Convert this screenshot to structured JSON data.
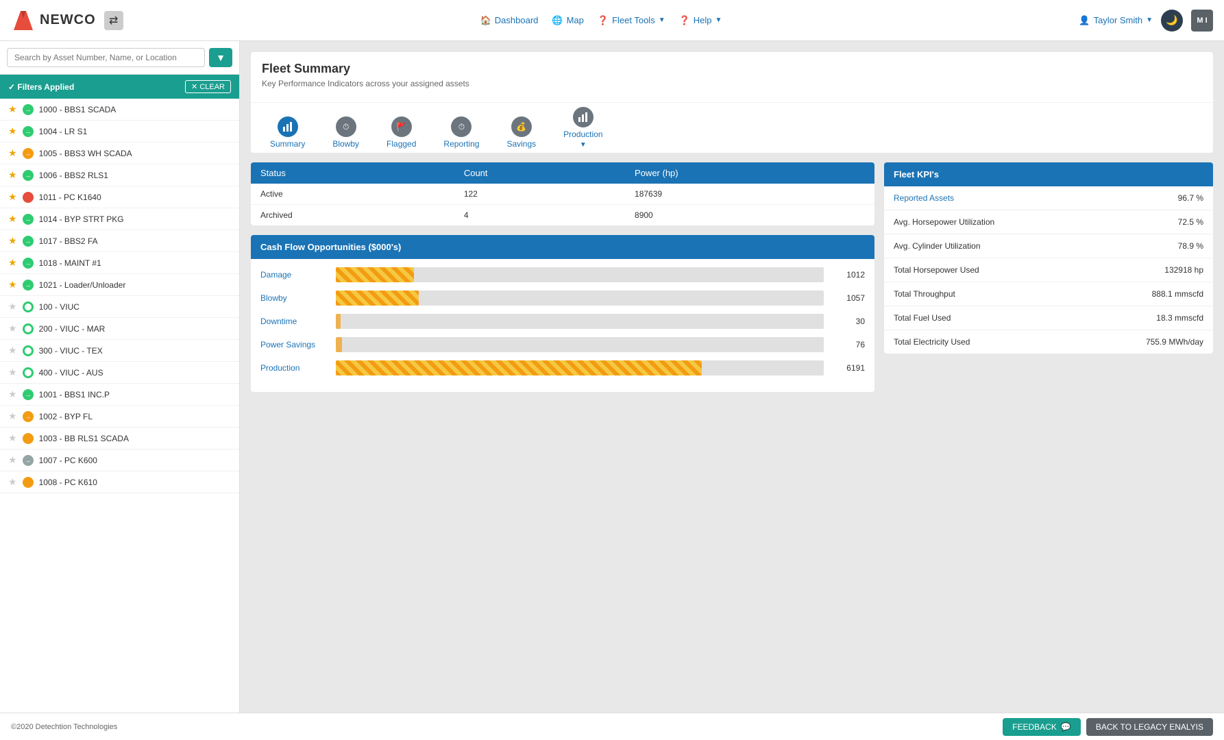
{
  "header": {
    "logo_text": "NEWCO",
    "nav_items": [
      {
        "label": "Dashboard",
        "icon": "🏠"
      },
      {
        "label": "Map",
        "icon": "🌐"
      },
      {
        "label": "Fleet Tools",
        "icon": "❓",
        "has_dropdown": true
      },
      {
        "label": "Help",
        "icon": "❓",
        "has_dropdown": true
      }
    ],
    "user_name": "Taylor Smith",
    "avatar_initials": "M I",
    "dark_mode_icon": "🌙"
  },
  "sidebar": {
    "search_placeholder": "Search by Asset Number, Name, or Location",
    "filters_applied_label": "✓ Filters Applied",
    "clear_label": "✕ CLEAR",
    "assets": [
      {
        "id": "1000",
        "name": "1000 - BBS1 SCADA",
        "starred": true,
        "status": "green-arrow"
      },
      {
        "id": "1004",
        "name": "1004 - LR S1",
        "starred": true,
        "status": "green-arrow"
      },
      {
        "id": "1005",
        "name": "1005 - BBS3 WH SCADA",
        "starred": true,
        "status": "orange-arrow"
      },
      {
        "id": "1006",
        "name": "1006 - BBS2 RLS1",
        "starred": true,
        "status": "green-arrow"
      },
      {
        "id": "1011",
        "name": "1011 - PC K1640",
        "starred": true,
        "status": "red-solid"
      },
      {
        "id": "1014",
        "name": "1014 - BYP STRT PKG",
        "starred": true,
        "status": "green-arrow"
      },
      {
        "id": "1017",
        "name": "1017 - BBS2 FA",
        "starred": true,
        "status": "green-arrow"
      },
      {
        "id": "1018",
        "name": "1018 - MAINT #1",
        "starred": true,
        "status": "green-arrow"
      },
      {
        "id": "1021",
        "name": "1021 - Loader/Unloader",
        "starred": true,
        "status": "green-arrow"
      },
      {
        "id": "100",
        "name": "100 - VIUC",
        "starred": false,
        "status": "ring-green"
      },
      {
        "id": "200",
        "name": "200 - VIUC - MAR",
        "starred": false,
        "status": "ring-green"
      },
      {
        "id": "300",
        "name": "300 - VIUC - TEX",
        "starred": false,
        "status": "ring-green"
      },
      {
        "id": "400",
        "name": "400 - VIUC - AUS",
        "starred": false,
        "status": "ring-green"
      },
      {
        "id": "1001",
        "name": "1001 - BBS1 INC.P",
        "starred": false,
        "status": "green-arrow"
      },
      {
        "id": "1002",
        "name": "1002 - BYP FL",
        "starred": false,
        "status": "orange-arrow"
      },
      {
        "id": "1003",
        "name": "1003 - BB RLS1 SCADA",
        "starred": false,
        "status": "orange-solid"
      },
      {
        "id": "1007",
        "name": "1007 - PC K600",
        "starred": false,
        "status": "gray-arrow"
      },
      {
        "id": "1008",
        "name": "1008 - PC K610",
        "starred": false,
        "status": "orange-solid"
      }
    ]
  },
  "fleet_summary": {
    "title": "Fleet Summary",
    "subtitle": "Key Performance Indicators across your assigned assets"
  },
  "tabs": [
    {
      "label": "Summary",
      "icon": "📊",
      "active": true,
      "color": "blue"
    },
    {
      "label": "Blowby",
      "icon": "⏱",
      "active": false,
      "color": "gray"
    },
    {
      "label": "Flagged",
      "icon": "🚩",
      "active": false,
      "color": "gray"
    },
    {
      "label": "Reporting",
      "icon": "⏱",
      "active": false,
      "color": "gray"
    },
    {
      "label": "Savings",
      "icon": "💰",
      "active": false,
      "color": "gray"
    },
    {
      "label": "Production",
      "icon": "📊",
      "active": false,
      "color": "gray",
      "has_dropdown": true
    }
  ],
  "status_table": {
    "headers": [
      "Status",
      "Count",
      "Power (hp)"
    ],
    "rows": [
      {
        "status": "Active",
        "count": "122",
        "power": "187639"
      },
      {
        "status": "Archived",
        "count": "4",
        "power": "8900"
      }
    ]
  },
  "cash_flow": {
    "title": "Cash Flow Opportunities ($000's)",
    "bars": [
      {
        "label": "Damage",
        "value": "1012",
        "pct": 16
      },
      {
        "label": "Blowby",
        "value": "1057",
        "pct": 17
      },
      {
        "label": "Downtime",
        "value": "30",
        "pct": 1
      },
      {
        "label": "Power Savings",
        "value": "76",
        "pct": 1.2
      },
      {
        "label": "Production",
        "value": "6191",
        "pct": 75
      }
    ]
  },
  "fleet_kpis": {
    "title": "Fleet KPI's",
    "rows": [
      {
        "label": "Reported Assets",
        "is_link": true,
        "value": "96.7 %"
      },
      {
        "label": "Avg. Horsepower Utilization",
        "is_link": false,
        "value": "72.5 %"
      },
      {
        "label": "Avg. Cylinder Utilization",
        "is_link": false,
        "value": "78.9 %"
      },
      {
        "label": "Total Horsepower Used",
        "is_link": false,
        "value": "132918 hp"
      },
      {
        "label": "Total Throughput",
        "is_link": false,
        "value": "888.1 mmscfd"
      },
      {
        "label": "Total Fuel Used",
        "is_link": false,
        "value": "18.3 mmscfd"
      },
      {
        "label": "Total Electricity Used",
        "is_link": false,
        "value": "755.9 MWh/day"
      }
    ]
  },
  "footer": {
    "copyright": "©2020 Detechtion Technologies",
    "feedback_label": "FEEDBACK",
    "legacy_label": "BACK TO LEGACY ENALYIS"
  }
}
